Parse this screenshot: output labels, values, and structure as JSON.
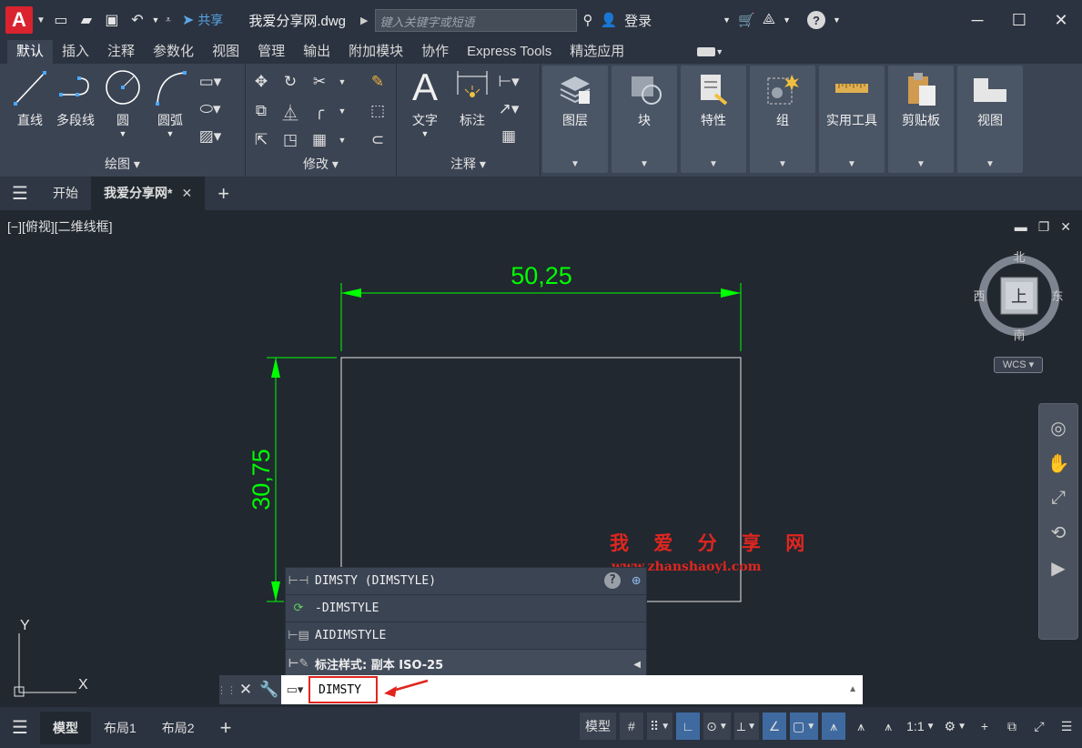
{
  "titlebar": {
    "app_letter": "A",
    "share_label": "共享",
    "file_title": "我爱分享网.dwg",
    "search_placeholder": "键入关键字或短语",
    "login_label": "登录"
  },
  "ribbon_tabs": [
    "默认",
    "插入",
    "注释",
    "参数化",
    "视图",
    "管理",
    "输出",
    "附加模块",
    "协作",
    "Express Tools",
    "精选应用"
  ],
  "ribbon": {
    "draw": {
      "title": "绘图",
      "line": "直线",
      "polyline": "多段线",
      "circle": "圆",
      "arc": "圆弧"
    },
    "modify": {
      "title": "修改"
    },
    "annotation": {
      "title": "注释",
      "text": "文字",
      "dimension": "标注"
    },
    "big_buttons": [
      "图层",
      "块",
      "特性",
      "组",
      "实用工具",
      "剪贴板",
      "视图"
    ]
  },
  "doc_tabs": {
    "start": "开始",
    "current": "我爱分享网*"
  },
  "viewport": {
    "view_label": "[−][俯视][二维线框]",
    "dim_horizontal": "50,25",
    "dim_vertical": "30,75",
    "ucs_x": "X",
    "ucs_y": "Y"
  },
  "viewcube": {
    "north": "北",
    "south": "南",
    "east": "东",
    "west": "西",
    "top": "上",
    "wcs": "WCS"
  },
  "autocomplete": [
    {
      "icon": "dimstyle-icon",
      "label": "DIMSTY (DIMSTYLE)"
    },
    {
      "icon": "dimstyle-refresh-icon",
      "label": "-DIMSTYLE"
    },
    {
      "icon": "ai-dimstyle-icon",
      "label": "AIDIMSTYLE"
    },
    {
      "icon": "dimstyle-category-icon",
      "label": "标注样式: 副本 ISO-25"
    }
  ],
  "watermark": {
    "title": "我 爱 分 享 网",
    "url": "www.zhanshaoyi.com"
  },
  "command_line": {
    "value": "DIMSTY"
  },
  "statusbar": {
    "model_tab": "模型",
    "layout1": "布局1",
    "layout2": "布局2",
    "model_btn": "模型",
    "scale": "1:1"
  },
  "colors": {
    "accent_green": "#00ff00",
    "highlight_red": "#e0261f",
    "canvas_bg": "#212830"
  }
}
